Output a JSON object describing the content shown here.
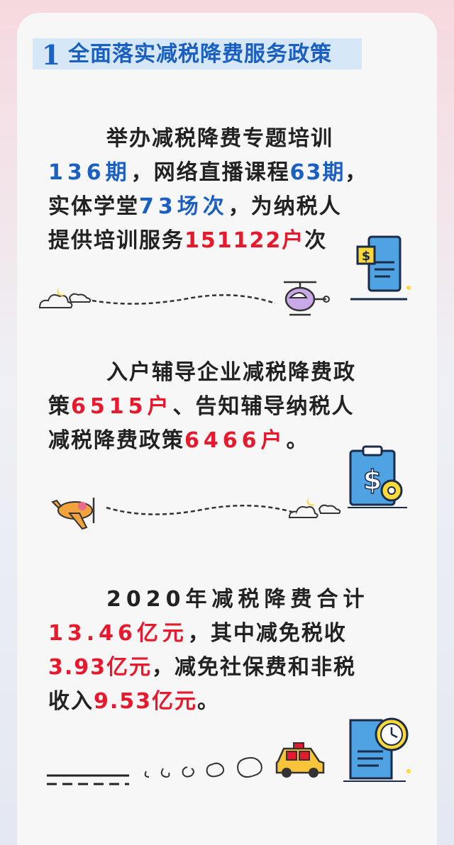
{
  "section": {
    "number": "1",
    "title": "全面落实减税降费服务政策"
  },
  "block1": {
    "l1": "举办减税降费专题培训",
    "l2a": "136期",
    "l2b": "，网络直播课程",
    "l2c": "63期",
    "l2d": "，",
    "l3a": "实体学堂",
    "l3b": "73场次",
    "l3c": "，为纳税人",
    "l4a": "提供培训服务",
    "l4b": "151122户",
    "l4c": "次"
  },
  "block2": {
    "l1": "入户辅导企业减税降费政",
    "l2a": "策",
    "l2b": "6515户",
    "l2c": "、告知辅导纳税人",
    "l3a": "减税降费政策",
    "l3b": "6466户",
    "l3c": "。"
  },
  "block3": {
    "l1": "2020年减税降费合计",
    "l2a": "13.46亿元",
    "l2b": "，其中减免税收",
    "l3a": "3.93亿元",
    "l3b": "，减免社保费和非税",
    "l4a": "收入",
    "l4b": "9.53亿元",
    "l4c": "。"
  },
  "icons": {
    "doc_dollar": "receipt-dollar-icon",
    "helicopter": "helicopter-icon",
    "clipboard_dollar_gear": "clipboard-dollar-gear-icon",
    "airplane": "airplane-icon",
    "car": "car-icon",
    "doc_clock": "document-clock-icon"
  },
  "colors": {
    "blue": "#1a5fc2",
    "red": "#e8192c",
    "header_bg": "#d6e7f8"
  }
}
